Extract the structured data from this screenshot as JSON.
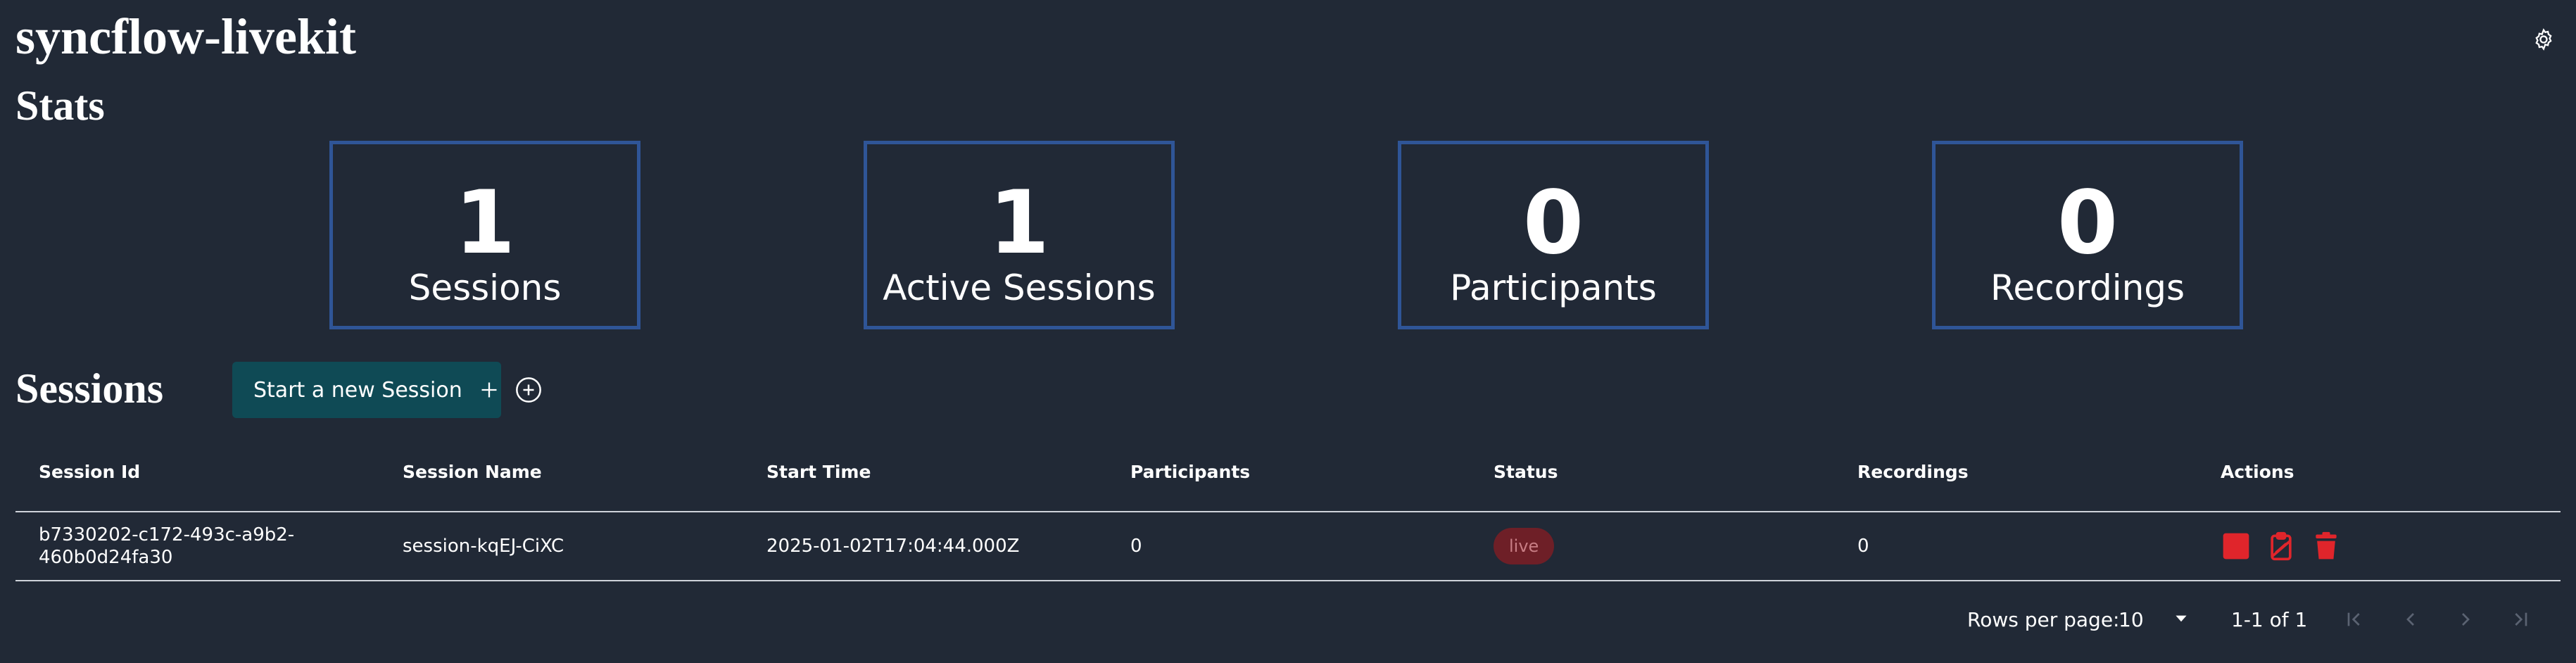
{
  "header": {
    "app_title": "syncflow-livekit",
    "settings_icon": "gear-icon"
  },
  "stats": {
    "title": "Stats",
    "cards": [
      {
        "value": "1",
        "label": "Sessions"
      },
      {
        "value": "1",
        "label": "Active Sessions"
      },
      {
        "value": "0",
        "label": "Participants"
      },
      {
        "value": "0",
        "label": "Recordings"
      }
    ]
  },
  "sessions": {
    "title": "Sessions",
    "start_button_label": "Start a new Session",
    "columns": [
      "Session Id",
      "Session Name",
      "Start Time",
      "Participants",
      "Status",
      "Recordings",
      "Actions"
    ],
    "rows": [
      {
        "session_id_line1": "b7330202-c172-493c-a9b2-",
        "session_id_line2": "460b0d24fa30",
        "session_name": "session-kqEJ-CiXC",
        "start_time": "2025-01-02T17:04:44.000Z",
        "participants": "0",
        "status": "live",
        "recordings": "0"
      }
    ]
  },
  "pagination": {
    "rows_per_page_label": "Rows per page:",
    "rows_per_page_value": "10",
    "range_text": "1-1 of 1"
  },
  "colors": {
    "background": "#212936",
    "card_border": "#2f5597",
    "primary_button": "#0f4a55",
    "danger": "#e0252b",
    "live_badge_bg": "#6e1f27"
  }
}
